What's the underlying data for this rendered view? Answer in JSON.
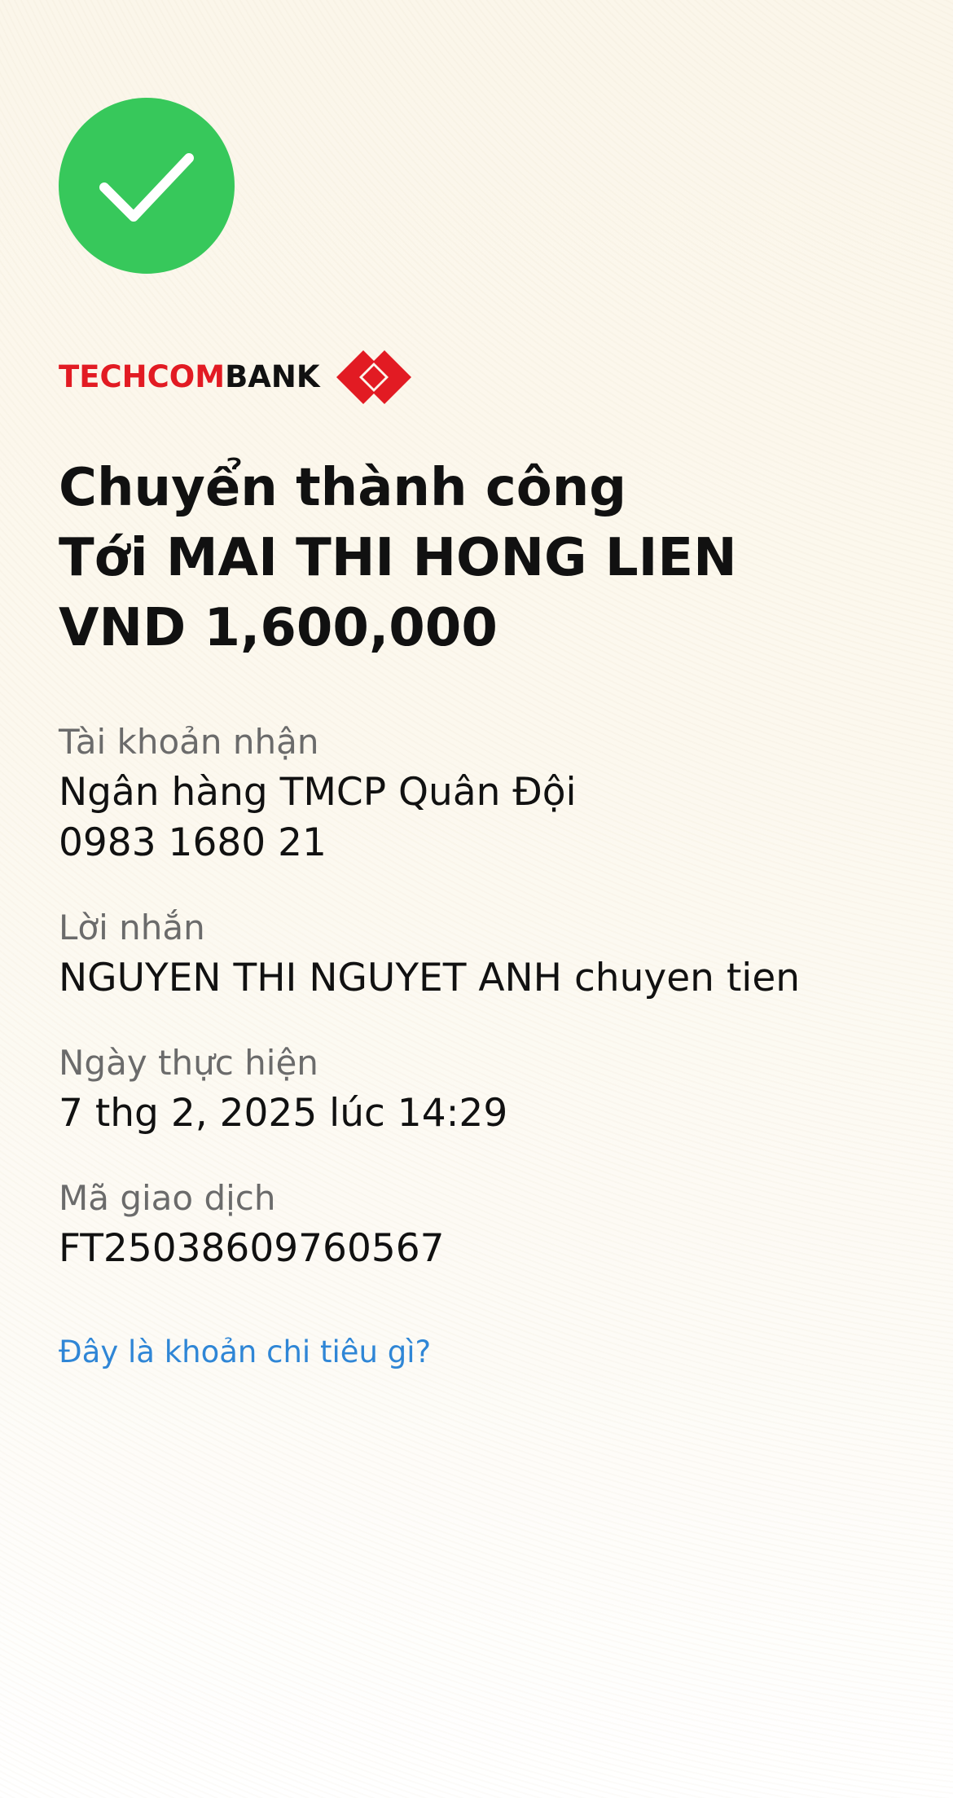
{
  "status_icon": "check-icon",
  "colors": {
    "success": "#37c85b",
    "brand_red": "#e21b23",
    "link": "#2f86d6"
  },
  "brand": {
    "name_part1": "TECHCOM",
    "name_part2": "BANK",
    "logo_icon": "techcombank-logo-icon"
  },
  "headline": {
    "line1": "Chuyển thành công",
    "line2": "Tới MAI THI HONG LIEN",
    "line3": "VND 1,600,000"
  },
  "details": {
    "receiving_account": {
      "label": "Tài khoản nhận",
      "bank": "Ngân hàng TMCP Quân Đội",
      "account_number": "0983 1680 21"
    },
    "message": {
      "label": "Lời nhắn",
      "value": "NGUYEN THI NGUYET ANH  chuyen tien"
    },
    "date": {
      "label": "Ngày thực hiện",
      "value": "7 thg 2, 2025 lúc 14:29"
    },
    "transaction_id": {
      "label": "Mã giao dịch",
      "value": "FT25038609760567"
    }
  },
  "link_label": "Đây là khoản chi tiêu gì?"
}
